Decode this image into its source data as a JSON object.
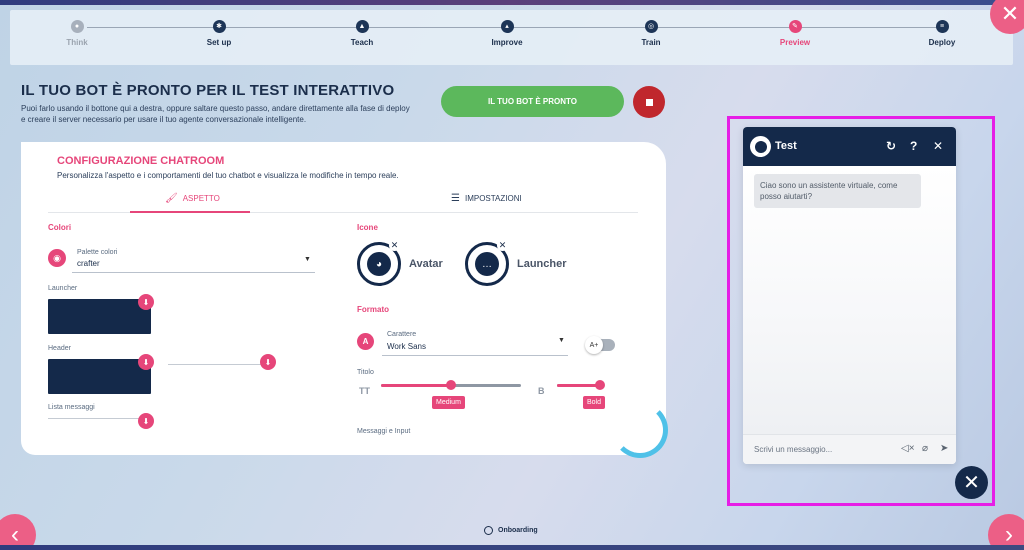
{
  "steps": [
    {
      "label": "Think"
    },
    {
      "label": "Set up"
    },
    {
      "label": "Teach"
    },
    {
      "label": "Improve"
    },
    {
      "label": "Train"
    },
    {
      "label": "Preview"
    },
    {
      "label": "Deploy"
    }
  ],
  "page": {
    "title": "IL TUO BOT È PRONTO PER IL TEST INTERATTIVO",
    "description": "Puoi farlo usando il bottone qui a destra, oppure saltare questo passo, andare direttamente alla fase di deploy e creare il server necessario per usare il tuo agente conversazionale intelligente.",
    "ready_button": "IL TUO BOT È PRONTO"
  },
  "config": {
    "title": "CONFIGURAZIONE CHATROOM",
    "subtitle": "Personalizza l'aspetto e i comportamenti del tuo chatbot e visualizza le modifiche in tempo reale.",
    "tabs": {
      "aspect": "ASPETTO",
      "settings": "IMPOSTAZIONI"
    },
    "colors": {
      "section": "Colori",
      "palette_label": "Palette colori",
      "palette_value": "crafter",
      "launcher_label": "Launcher",
      "header_label": "Header",
      "messages_label": "Lista messaggi"
    },
    "icons": {
      "section": "Icone",
      "avatar_label": "Avatar",
      "launcher_label": "Launcher"
    },
    "format": {
      "section": "Formato",
      "font_label": "Carattere",
      "font_value": "Work Sans",
      "title_label": "Titolo",
      "size_tag": "Medium",
      "weight_tag": "Bold",
      "size_icon": "TT",
      "weight_icon": "B",
      "toggle_label": "A+",
      "messages_label": "Messaggi e Input",
      "size_level": 0.5,
      "weight_level": 1.0
    }
  },
  "chat": {
    "title": "Test",
    "greeting": "Ciao sono un assistente virtuale, come posso aiutarti?",
    "input_placeholder": "Scrivi un messaggio..."
  },
  "footer": {
    "onboarding": "Onboarding"
  },
  "colors": {
    "accent": "#e6467a",
    "navy": "#14294a",
    "green": "#5cb85c",
    "stop": "#c0272d",
    "highlight": "#e61ee6"
  }
}
